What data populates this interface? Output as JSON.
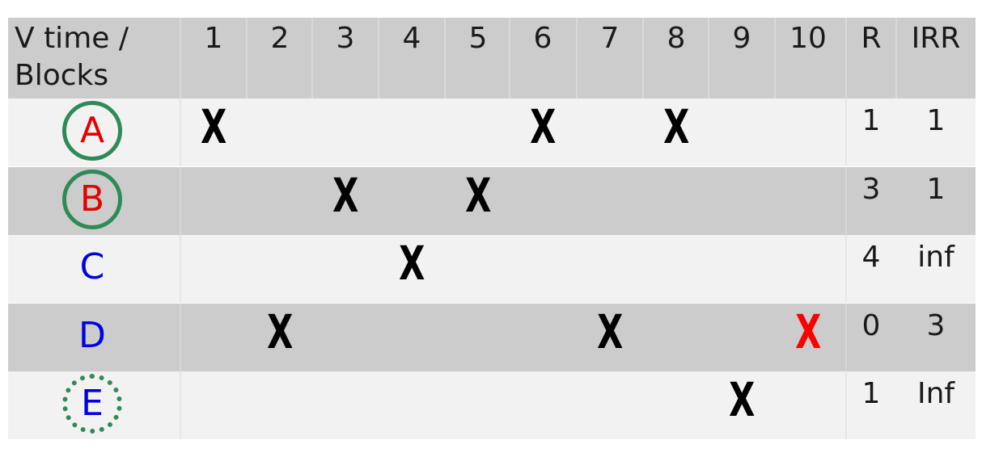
{
  "header": {
    "label_line1": "V time /",
    "label_line2": "Blocks",
    "times": [
      "1",
      "2",
      "3",
      "4",
      "5",
      "6",
      "7",
      "8",
      "9",
      "10"
    ],
    "r_label": "R",
    "irr_label": "IRR"
  },
  "rows": [
    {
      "block": "A",
      "block_color": "#e60000",
      "circle": "solid",
      "marks": [
        1,
        6,
        8
      ],
      "red_marks": [],
      "r": "1",
      "irr": "1"
    },
    {
      "block": "B",
      "block_color": "#e60000",
      "circle": "solid",
      "marks": [
        3,
        5
      ],
      "red_marks": [],
      "r": "3",
      "irr": "1"
    },
    {
      "block": "C",
      "block_color": "#0000e6",
      "circle": "none",
      "marks": [
        4
      ],
      "red_marks": [],
      "r": "4",
      "irr": "inf"
    },
    {
      "block": "D",
      "block_color": "#0000e6",
      "circle": "none",
      "marks": [
        2,
        7
      ],
      "red_marks": [
        10
      ],
      "r": "0",
      "irr": "3"
    },
    {
      "block": "E",
      "block_color": "#0000e6",
      "circle": "dashed",
      "marks": [
        9
      ],
      "red_marks": [],
      "r": "1",
      "irr": "Inf"
    }
  ],
  "mark_symbol": "X",
  "colors": {
    "circle_green": "#2e8b57",
    "mark_black": "#000000",
    "mark_red": "#ff0000"
  }
}
